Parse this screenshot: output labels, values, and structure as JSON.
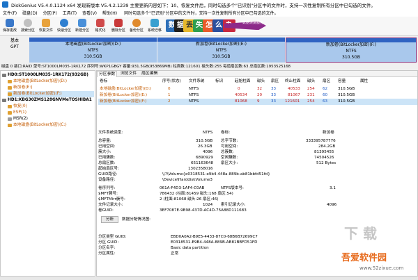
{
  "window": {
    "title": "DiskGenius V5.4.0.1124 x64   发现新版本 V5.4.2.1239 主要更新内容如下：10、恢复文件后，同时勾选多个\"已识别\"分区中的文件时，支持一次性复制所有分区中已勾选的文件。"
  },
  "menu": {
    "items": [
      "文件(F)",
      "磁盘(D)",
      "分区(P)",
      "工具(T)",
      "查看(V)",
      "帮助(H)"
    ],
    "promo": "同时勾选多个\"已识别\"分区中的文件时，支持一次性复制所有分区中已勾选的文件。"
  },
  "toolbar": {
    "buttons": [
      {
        "label": "保存更改",
        "icon": "save-icon"
      },
      {
        "label": "搜索分区",
        "icon": "search-icon"
      },
      {
        "label": "恢复文件",
        "icon": "recover-icon"
      },
      {
        "label": "快速分区",
        "icon": "quick-partition-icon"
      },
      {
        "label": "新建分区",
        "icon": "new-partition-icon"
      },
      {
        "label": "格式化",
        "icon": "format-icon"
      },
      {
        "label": "删除分区",
        "icon": "delete-icon"
      },
      {
        "label": "备份分区",
        "icon": "backup-icon"
      },
      {
        "label": "系统迁移",
        "icon": "migrate-icon"
      }
    ],
    "ad_chars": [
      "数",
      "据",
      "丢",
      "失",
      "怎",
      "么",
      "办"
    ],
    "ad_text": "数据恢复服务"
  },
  "diskmap": {
    "disk_label_1": "基本",
    "disk_label_2": "GPT",
    "partitions": [
      {
        "name": "本地磁盘(BitLocker加密)(D:)",
        "fs": "NTFS",
        "size": "310.5GB"
      },
      {
        "name": "新加卷(BitLocker加密)(E:)",
        "fs": "NTFS",
        "size": "310.5GB"
      },
      {
        "name": "新加卷(BitLocker加密)(F:)",
        "fs": "NTFS",
        "size": "310.5GB"
      }
    ]
  },
  "diskinfo": "磁盘 0 接口:RAID  型号:ST1000LM035-1RK172  序列号:WKP1GBGY  容量:931.5GB(953869MB)  柱面数:121601  磁头数:255  每道扇区数:63  总扇区数:1953525168",
  "tree": {
    "nodes": [
      {
        "text": "HD0:ST1000LM035-1RK172(932GB)"
      },
      {
        "text": "本地磁盘(BitLocker加密)(D:)"
      },
      {
        "text": "新加卷(E:)"
      },
      {
        "text": "新加卷(BitLocker加密)(F:)"
      },
      {
        "text": "HD1:KBG30ZMS128GNVMeTOSHIBA1"
      },
      {
        "text": "恢复(0)"
      },
      {
        "text": "ESP(1)"
      },
      {
        "text": "MSR(2)"
      },
      {
        "text": "本地磁盘(BitLocker加密)(C:)"
      }
    ]
  },
  "tabs": [
    "分区参数",
    "浏览文件",
    "扇区编辑"
  ],
  "partition_table": {
    "headers": [
      "卷标",
      "序号(状态)",
      "文件系统",
      "标识",
      "起始柱面",
      "磁头",
      "扇区",
      "终止柱面",
      "磁头",
      "扇区",
      "容量",
      "属性"
    ],
    "rows": [
      [
        "本地磁盘(BitLocker加密)(D:)",
        "0",
        "NTFS",
        "",
        "0",
        "32",
        "33",
        "40533",
        "254",
        "62",
        "310.5GB",
        ""
      ],
      [
        "新加卷(BitLocker加密)(E:)",
        "1",
        "NTFS",
        "",
        "40534",
        "20",
        "33",
        "81067",
        "231",
        "60",
        "310.5GB",
        ""
      ],
      [
        "新加卷(BitLocker加密)(F:)",
        "2",
        "NTFS",
        "",
        "81068",
        "9",
        "33",
        "121601",
        "254",
        "63",
        "310.5GB",
        ""
      ]
    ]
  },
  "details": {
    "fs_type_label": "文件系统类型:",
    "fs_type_value": "NTFS",
    "volume_label": "卷标:",
    "volume_value": "新加卷",
    "left_labels": [
      "总容量:",
      "已用空间:",
      "簇大小:",
      "已用簇数:",
      "总扇区数:",
      "起始扇区号:",
      "GUID路径:",
      "设备路径:"
    ],
    "left_values": [
      "310.5GB",
      "26.3GB",
      "4096",
      "6890929",
      "651163648",
      "1302358016",
      "\\\\?\\Volume{e0318531-e9b4-448a-889b-ab81bbfd51fd}",
      "\\Device\\HarddiskVolume3"
    ],
    "right_labels": [
      "总字节数:",
      "可用空间:",
      "总簇数:",
      "空闲簇数:",
      "扇区大小:"
    ],
    "right_values": [
      "333395787776",
      "284.2GB",
      "81395455",
      "74504526",
      "512 Bytes"
    ],
    "left_labels_2": [
      "卷序列号:",
      "$MFT簇号:",
      "$MFTMirr簇号:",
      "文件记录大小:",
      "卷GUID:"
    ],
    "left_values_2": [
      "061A-F4D3-1AF4-C0AB",
      "786432 (柱面:81459 磁头:168 扇区:54)",
      "2 (柱面:81068 磁头:26 扇区:46)",
      "1024",
      "3EF7087E-9B98-437D-AC4D-75A88D111683"
    ],
    "right_labels_2": [
      "NTFS版本号:",
      "",
      "",
      "索引记录大小:"
    ],
    "right_values_2": [
      "3.1",
      "",
      "",
      "4096"
    ],
    "analyze_button": "分析",
    "analyze_label": "数据分配情况图:",
    "type_labels": [
      "分区类型 GUID:",
      "分区 GUID:",
      "分区名字:",
      "分区属性:"
    ],
    "type_values": [
      "EBD0A0A2-B9E5-4433-87C0-68B6B72699C7",
      "E0318531-E9B4-448A-889B-AB81BBFD51FD",
      "Basic data partition",
      "正常"
    ]
  },
  "watermark": {
    "line1": "下 载",
    "line2": "吾爱软件园",
    "line3": "www.52zixue.com"
  }
}
